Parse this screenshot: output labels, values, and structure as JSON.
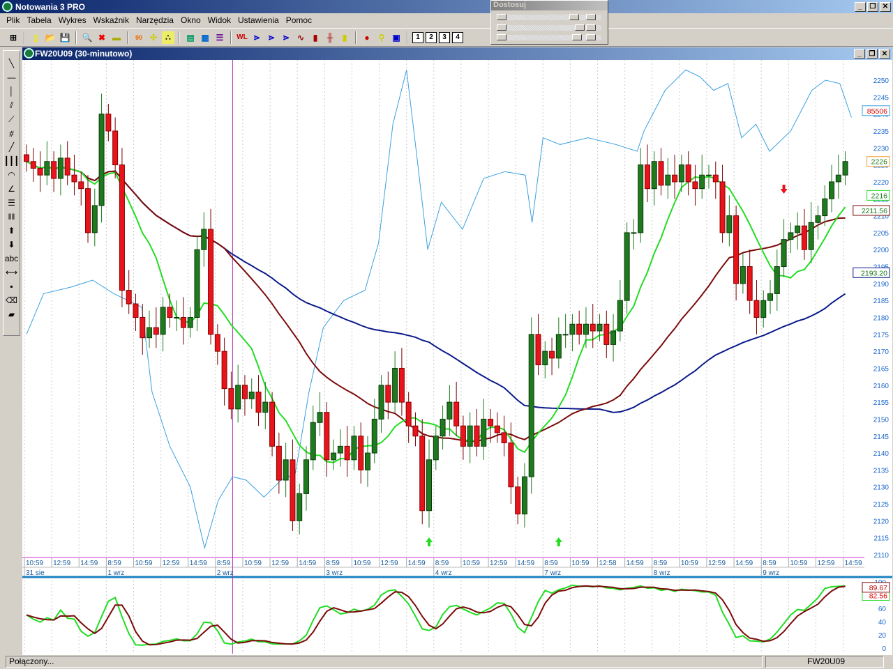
{
  "app": {
    "title": "Notowania 3 PRO"
  },
  "menu": [
    "Plik",
    "Tabela",
    "Wykres",
    "Wskaźnik",
    "Narzędzia",
    "Okno",
    "Widok",
    "Ustawienia",
    "Pomoc"
  ],
  "toolbar": {
    "layout_buttons": [
      "1",
      "2",
      "3",
      "4"
    ]
  },
  "adjust_window": {
    "title": "Dostosuj"
  },
  "left_tools": {
    "text_tool": "abc"
  },
  "chart_window": {
    "title": "FW20U09 (30-minutowo)"
  },
  "status": {
    "connection": "Połączony...",
    "symbol": "FW20U09"
  },
  "colors": {
    "up": "#1f7a1f",
    "down": "#e8141c",
    "sma_short": "#22dd22",
    "sma_mid": "#7a0a0a",
    "sma_long": "#0a1a8a",
    "oi": "#3aa0e0",
    "axis": "#1a66cc"
  },
  "chart_data": {
    "type": "candlestick",
    "symbol": "FW20U09",
    "interval": "30-minutowo",
    "ylim": [
      2110,
      2250
    ],
    "y_ticks": [
      2110,
      2115,
      2120,
      2125,
      2130,
      2135,
      2140,
      2145,
      2150,
      2155,
      2160,
      2165,
      2170,
      2175,
      2180,
      2185,
      2190,
      2195,
      2200,
      2205,
      2210,
      2215,
      2220,
      2225,
      2230,
      2235,
      2240,
      2245,
      2250
    ],
    "close": [
      2226,
      2224,
      2222,
      2226,
      2221,
      2227,
      2222,
      2220,
      2218,
      2205,
      2213,
      2240,
      2235,
      2225,
      2188,
      2184,
      2180,
      2174,
      2177,
      2175,
      2183,
      2180,
      2180,
      2177,
      2180,
      2200,
      2206,
      2175,
      2170,
      2159,
      2153,
      2160,
      2156,
      2158,
      2152,
      2155,
      2142,
      2132,
      2138,
      2120,
      2128,
      2138,
      2149,
      2152,
      2138,
      2140,
      2142,
      2138,
      2145,
      2135,
      2140,
      2150,
      2160,
      2155,
      2165,
      2155,
      2148,
      2145,
      2123,
      2138,
      2145,
      2150,
      2155,
      2148,
      2142,
      2148,
      2142,
      2150,
      2148,
      2146,
      2143,
      2130,
      2122,
      2133,
      2175,
      2166,
      2170,
      2168,
      2175,
      2175,
      2178,
      2175,
      2178,
      2176,
      2178,
      2172,
      2176,
      2185,
      2205,
      2205,
      2225,
      2218,
      2226,
      2219,
      2222,
      2220,
      2225,
      2220,
      2218,
      2222,
      2222,
      2220,
      2205,
      2210,
      2190,
      2195,
      2185,
      2180,
      2185,
      2187,
      2195,
      2203,
      2205,
      2207,
      2200,
      2208,
      2210,
      2215,
      2220,
      2222,
      2226
    ],
    "open_rule": "previous close",
    "oi_line": [
      [
        0,
        2175
      ],
      [
        2.5,
        2187
      ],
      [
        6.6,
        2189
      ],
      [
        9.7,
        2191
      ],
      [
        12.8,
        2187
      ],
      [
        14.9,
        2185
      ],
      [
        16.9,
        2183
      ],
      [
        18.4,
        2158
      ],
      [
        21,
        2142
      ],
      [
        24,
        2130
      ],
      [
        26.1,
        2112
      ],
      [
        28.1,
        2126
      ],
      [
        30.2,
        2133
      ],
      [
        32.2,
        2132
      ],
      [
        34.8,
        2127
      ],
      [
        37.3,
        2132
      ],
      [
        39.4,
        2134
      ],
      [
        41.4,
        2158
      ],
      [
        43.5,
        2177
      ],
      [
        46.5,
        2185
      ],
      [
        49.6,
        2188
      ],
      [
        51.6,
        2202
      ],
      [
        53.7,
        2237
      ],
      [
        55.7,
        2253
      ],
      [
        57.3,
        2226
      ],
      [
        58.8,
        2200
      ],
      [
        60.8,
        2214
      ],
      [
        63.9,
        2206
      ],
      [
        67,
        2221
      ],
      [
        70.1,
        2223
      ],
      [
        73.1,
        2222
      ],
      [
        74.1,
        2208
      ],
      [
        75.7,
        2233
      ],
      [
        78.2,
        2231
      ],
      [
        82.3,
        2233
      ],
      [
        86.4,
        2231
      ],
      [
        89.5,
        2229
      ],
      [
        90.5,
        2235
      ],
      [
        93.6,
        2247
      ],
      [
        96.6,
        2253
      ],
      [
        98.7,
        2251
      ],
      [
        100.7,
        2247
      ],
      [
        102.8,
        2249
      ],
      [
        104.8,
        2233
      ],
      [
        106.9,
        2237
      ],
      [
        108.9,
        2229
      ],
      [
        112,
        2235
      ],
      [
        115.1,
        2247
      ],
      [
        117.1,
        2250
      ],
      [
        119.2,
        2249
      ],
      [
        120.9,
        2239
      ]
    ],
    "oi_label": "85506",
    "indicator_periods": {
      "sma_short": 9,
      "sma_mid": 30,
      "sma_long": 60,
      "stoch": 14
    },
    "last_values": {
      "close": "2226",
      "sma_short": "2216",
      "sma_mid": "2211.56",
      "sma_long": "2193.20"
    },
    "signals": [
      {
        "type": "buy",
        "index": 59
      },
      {
        "type": "buy",
        "index": 78
      },
      {
        "type": "sell",
        "index": 111
      }
    ],
    "cursor_index": 30,
    "time_ticks": [
      "10:59",
      "12:59",
      "14:59",
      "8:59",
      "10:59",
      "12:59",
      "14:59",
      "8:59",
      "10:59",
      "12:59",
      "14:59",
      "8:59",
      "10:59",
      "12:59",
      "14:59",
      "8:59",
      "10:59",
      "12:59",
      "14:59",
      "8:59",
      "10:59",
      "12:58",
      "14:59",
      "8:59",
      "10:59",
      "12:59",
      "14:59",
      "8:59",
      "10:59",
      "12:59",
      "14:59"
    ],
    "date_ticks": [
      {
        "tick": 0,
        "label": "31 sie"
      },
      {
        "tick": 3,
        "label": "1 wrz"
      },
      {
        "tick": 7,
        "label": "2 wrz"
      },
      {
        "tick": 11,
        "label": "3 wrz"
      },
      {
        "tick": 15,
        "label": "4 wrz"
      },
      {
        "tick": 19,
        "label": "7 wrz"
      },
      {
        "tick": 23,
        "label": "8 wrz"
      },
      {
        "tick": 27,
        "label": "9 wrz"
      }
    ],
    "stoch": {
      "ylim": [
        0,
        100
      ],
      "y_ticks": [
        0,
        20,
        40,
        60,
        80,
        100
      ],
      "k_label": "89.67",
      "d_label": "82.56"
    }
  }
}
